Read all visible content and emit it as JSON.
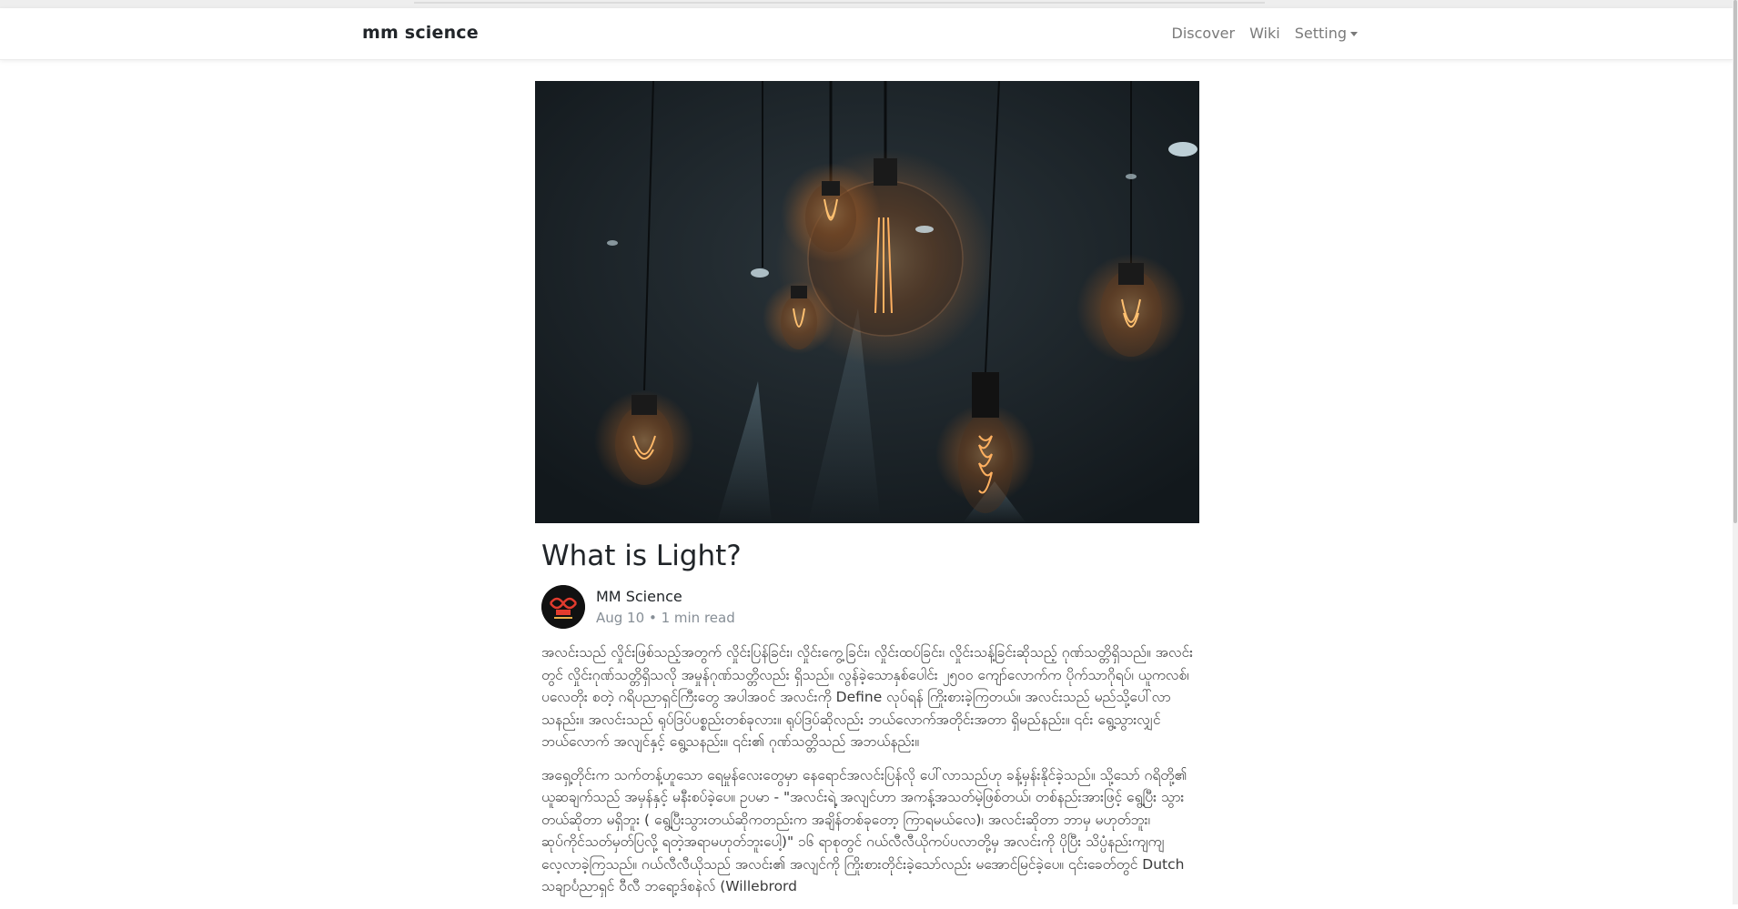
{
  "navbar": {
    "brand": "mm science",
    "links": [
      {
        "label": "Discover"
      },
      {
        "label": "Wiki"
      },
      {
        "label": "Setting"
      }
    ]
  },
  "article": {
    "title": "What is Light?",
    "author": "MM Science",
    "date": "Aug 10",
    "separator": "•",
    "read_time": "1 min read",
    "paragraphs": [
      "အလင်းသည် လှိုင်းဖြစ်သည့်အတွက် လှိုင်းပြန်ခြင်း၊ လှိုင်းကွေ့ခြင်း၊ လှိုင်းထပ်ခြင်း၊ လှိုင်းသန့်ခြင်းဆိုသည့် ဂုဏ်သတ္တိရှိသည်။ အလင်းတွင် လှိုင်းဂုဏ်သတ္တိရှိသလို အမှုန်ဂုဏ်သတ္တိလည်း ရှိသည်။ လွန်ခဲ့သောနှစ်ပေါင်း ၂၅၀၀ ကျော်လောက်က ပိုက်သာဂိုရပ်၊ ယူကလစ်၊ ပလေတိုး စတဲ့ ဂရိပညာရှင်ကြီးတွေ အပါအဝင် အလင်းကို Define လုပ်ရန် ကြိုးစားခဲ့ကြတယ်။ အလင်းသည် မည်သို့ပေါ်လာသနည်း။ အလင်းသည် ရုပ်ဒြပ်ပစ္စည်းတစ်ခုလား။ ရုပ်ဒြပ်ဆိုလည်း ဘယ်လောက်အတိုင်းအတာ ရှိမည်နည်း။ ၎င်း ရွေ့သွားလျှင် ဘယ်လောက် အလျင်နှင့် ရွေ့သနည်း။ ၎င်း၏ ဂုဏ်သတ္တိသည် အဘယ်နည်း။",
      "အရှေ့တိုင်းက သက်တန့်ဟူသော ရေမှုန်လေးတွေမှာ နေရောင်အလင်းပြန်လို ပေါ်လာသည်ဟု ခန့်မှန်းနိုင်ခဲ့သည်။ သို့သော် ဂရိတို့၏ ယူဆချက်သည် အမှန်နှင့် မနီးစပ်ခဲ့ပေ။ ဥပမာ - \"အလင်းရဲ့ အလျင်ဟာ အကန့်အသတ်မဲ့ဖြစ်တယ်၊ တစ်နည်းအားဖြင့် ရွေ့ပြီး သွားတယ်ဆိုတာ မရှိဘူး ( ရွေ့ပြီးသွားတယ်ဆိုကတည်းက အချိန်တစ်ခုတော့ ကြာရမယ်လေ)၊ အလင်းဆိုတာ ဘာမှ မဟုတ်ဘူး၊ ဆုပ်ကိုင်သတ်မှတ်ပြလို့ ရတဲ့အရာမဟုတ်ဘူးပေါ့)\" ၁၆ ရာစုတွင် ဂယ်လီလီယိုကပ်ပလာတို့မှ အလင်းကို ပိုပြီး သိပ္ပံနည်းကျကျ လေ့လာခဲ့ကြသည်။ ဂယ်လီလီယိုသည် အလင်း၏ အလျင်ကို ကြိုးစားတိုင်းခဲ့သော်လည်း မအောင်မြင်ခဲ့ပေ။ ၎င်းခေတ်တွင် Dutch သချာင်္ပညာရှင် ဝီလီ ဘရော့ဒ်စနဲလ် (Willebrord"
    ]
  },
  "colors": {
    "brand_text": "#212529",
    "nav_link": "#7a7a7a",
    "meta_text": "#868e96",
    "body_text": "#3a3a3a",
    "hero_bg": "#1c2328",
    "bulb_glow": "#f39a4a"
  },
  "icons": {
    "hero_image": "hanging-light-bulbs-photo",
    "avatar": "mm-science-logo",
    "dropdown": "caret-down-icon"
  }
}
